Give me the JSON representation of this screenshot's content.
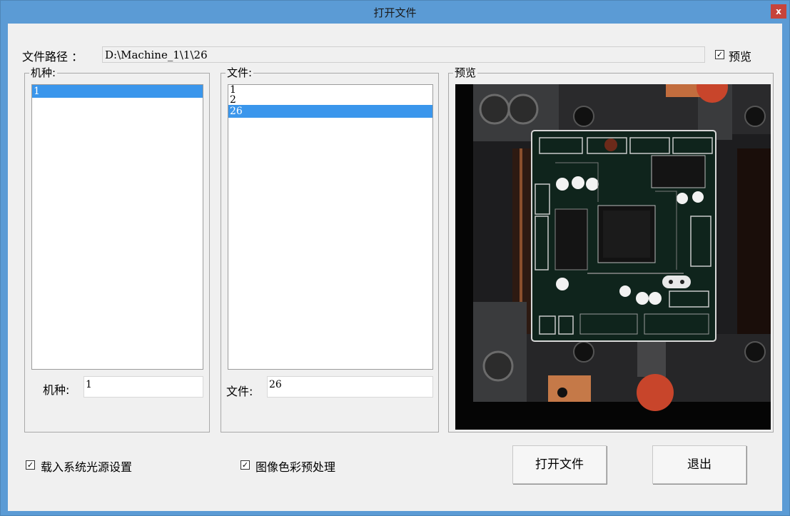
{
  "window": {
    "title": "打开文件",
    "close_label": "x"
  },
  "path": {
    "label": "文件路径 ：",
    "value": "D:\\Machine_1\\1\\26"
  },
  "preview_toggle": {
    "label": "预览",
    "checked": true
  },
  "machine_group": {
    "title": "机种:",
    "items": [
      "1"
    ],
    "selected": "1",
    "edit_label": "机种:",
    "edit_value": "1"
  },
  "file_group": {
    "title": "文件:",
    "items": [
      "1",
      "2",
      "26"
    ],
    "selected": "26",
    "edit_label": "文件:",
    "edit_value": "26"
  },
  "preview_group": {
    "title": "预览"
  },
  "options": {
    "load_light": {
      "label": "载入系统光源设置",
      "checked": true
    },
    "color_preprocess": {
      "label": "图像色彩预处理",
      "checked": true
    }
  },
  "buttons": {
    "open": "打开文件",
    "exit": "退出"
  },
  "colors": {
    "titlebar": "#5b9bd5",
    "selection": "#3a96ec",
    "close": "#c7443b"
  }
}
